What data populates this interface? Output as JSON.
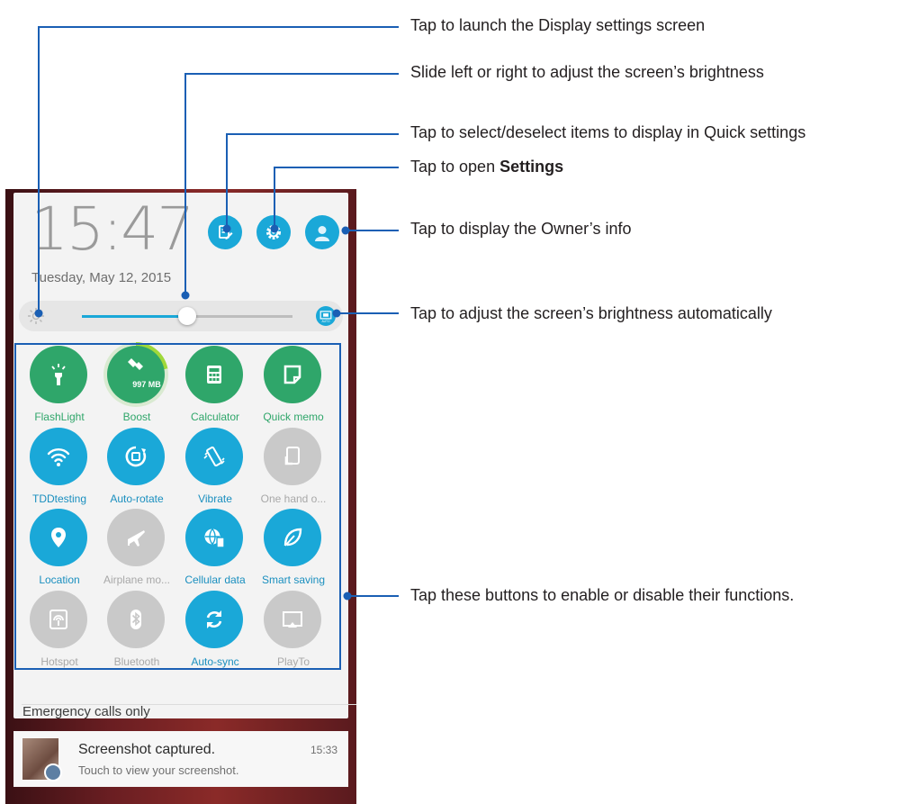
{
  "status": {
    "time": "15:47",
    "date": "Tuesday, May 12, 2015"
  },
  "header_buttons": {
    "edit_icon": "edit-quick-settings-icon",
    "settings_icon": "gear-icon",
    "owner_icon": "user-avatar-icon"
  },
  "brightness": {
    "level": 0.5,
    "auto_label": "AUTO"
  },
  "tiles": [
    {
      "label": "FlashLight",
      "state": "on-green",
      "icon": "flashlight-icon"
    },
    {
      "label": "Boost",
      "state": "on-green",
      "icon": "boost-icon",
      "value": "997 MB"
    },
    {
      "label": "Calculator",
      "state": "on-green",
      "icon": "calculator-icon"
    },
    {
      "label": "Quick memo",
      "state": "on-green",
      "icon": "memo-icon"
    },
    {
      "label": "TDDtesting",
      "state": "on-blue",
      "icon": "wifi-icon"
    },
    {
      "label": "Auto-rotate",
      "state": "on-blue",
      "icon": "rotate-icon"
    },
    {
      "label": "Vibrate",
      "state": "on-blue",
      "icon": "vibrate-icon"
    },
    {
      "label": "One hand o...",
      "state": "off",
      "icon": "one-hand-icon"
    },
    {
      "label": "Location",
      "state": "on-blue",
      "icon": "location-pin-icon"
    },
    {
      "label": "Airplane mo...",
      "state": "off",
      "icon": "airplane-icon"
    },
    {
      "label": "Cellular data",
      "state": "on-blue",
      "icon": "cellular-data-icon"
    },
    {
      "label": "Smart saving",
      "state": "on-blue",
      "icon": "leaf-icon"
    },
    {
      "label": "Hotspot",
      "state": "off",
      "icon": "hotspot-icon"
    },
    {
      "label": "Bluetooth",
      "state": "off",
      "icon": "bluetooth-icon"
    },
    {
      "label": "Auto-sync",
      "state": "on-blue",
      "icon": "sync-icon"
    },
    {
      "label": "PlayTo",
      "state": "off",
      "icon": "cast-icon"
    }
  ],
  "footer": {
    "emergency": "Emergency calls only"
  },
  "notification": {
    "title": "Screenshot captured.",
    "text": "Touch to view your screenshot.",
    "time": "15:33"
  },
  "callouts": {
    "display_settings": "Tap to launch the Display settings screen",
    "brightness_slider": "Slide left or right to adjust the screen’s brightness",
    "edit_items": "Tap to select/deselect items to display in Quick settings",
    "open_settings_prefix": "Tap to open ",
    "open_settings_bold": "Settings",
    "owner_info": "Tap to display the Owner’s info",
    "auto_brightness": "Tap to adjust the screen’s brightness automatically",
    "toggle_buttons": "Tap these buttons to enable or disable their functions."
  },
  "colors": {
    "accent_blue": "#1aa8d8",
    "accent_green": "#2fa66a",
    "disabled_gray": "#c9c9c9",
    "callout_line": "#1a5fb4"
  }
}
